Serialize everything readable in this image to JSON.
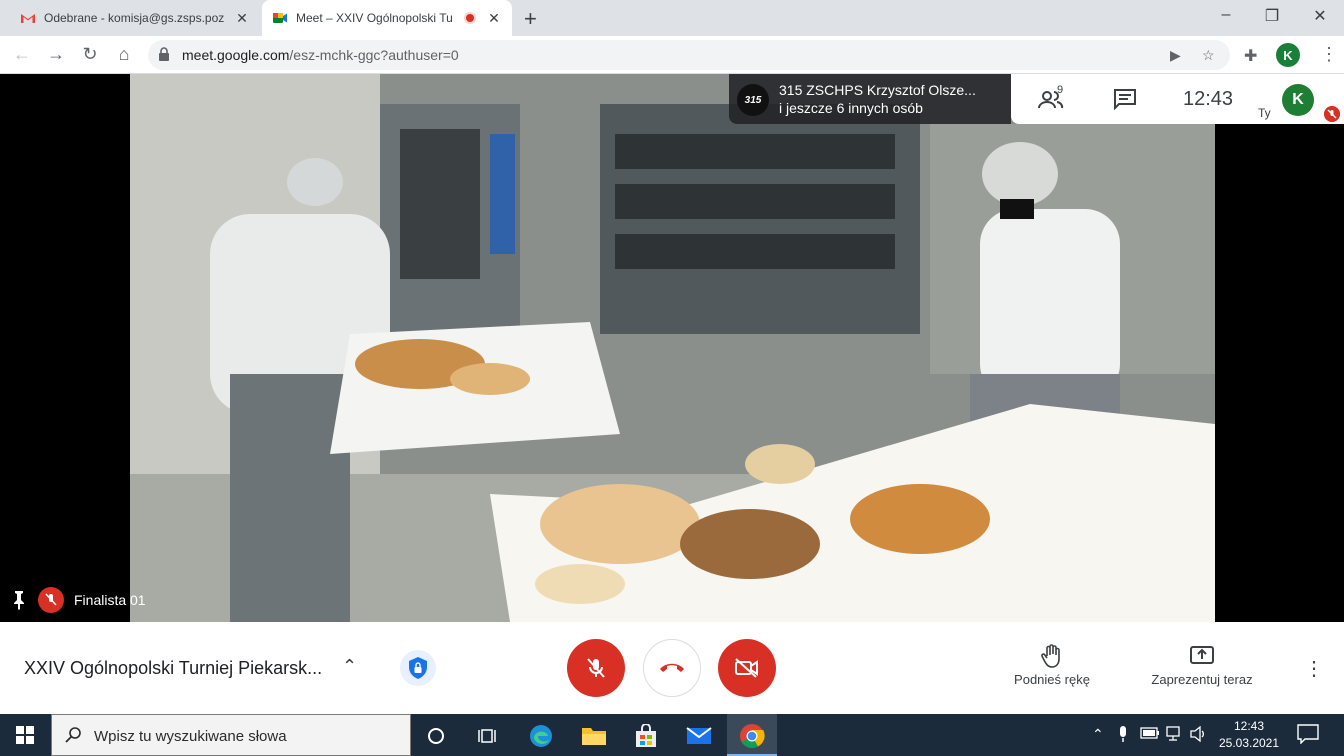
{
  "browser": {
    "tabs": [
      {
        "title": "Odebrane - komisja@gs.zsps.poz",
        "favicon": "gmail-icon",
        "close": "✕"
      },
      {
        "title": "Meet – XXIV Ogólnopolski Tu",
        "favicon": "meet-icon",
        "close": "✕"
      }
    ],
    "new_tab": "+",
    "window_controls": {
      "minimize": "–",
      "restore": "❐",
      "close": "✕"
    },
    "url_host": "meet.google.com",
    "url_path": "/esz-mchk-ggc?authuser=0",
    "profile_initial": "K",
    "menu": "⋮"
  },
  "meet": {
    "presenter": {
      "logo_text": "315",
      "logo_sub": "ZSCHPS",
      "name": "315 ZSCHPS Krzysztof Olsze...",
      "others": "i jeszcze 6 innych osób"
    },
    "participants_count": "9",
    "clock": "12:43",
    "self_label": "Ty",
    "self_initial": "K",
    "tile_name": "Finalista 01",
    "meeting_title": "XXIV Ogólnopolski Turniej Piekarsk...",
    "raise_hand_label": "Podnieś rękę",
    "present_label": "Zaprezentuj teraz",
    "colors": {
      "red": "#d93025",
      "green": "#188038",
      "blue": "#1a73e8"
    }
  },
  "taskbar": {
    "search_placeholder": "Wpisz tu wyszukiwane słowa",
    "time": "12:43",
    "date": "25.03.2021"
  }
}
